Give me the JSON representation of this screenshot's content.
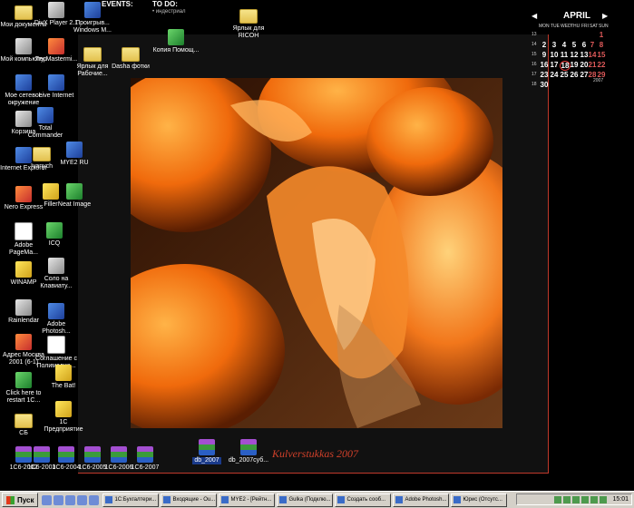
{
  "desktop_left_icons": [
    {
      "label": "Мои документы",
      "icon": "folder-icon"
    },
    {
      "label": "Мой компьютер",
      "icon": "computer-icon"
    },
    {
      "label": "Мое сетевое окружение",
      "icon": "network-icon"
    },
    {
      "label": "Корзина",
      "icon": "recycle-bin-icon"
    },
    {
      "label": "Internet Explorer",
      "icon": "ie-icon"
    },
    {
      "label": "Nero Express",
      "icon": "nero-icon"
    },
    {
      "label": "Adobe PageMa...",
      "icon": "pagemaker-icon"
    },
    {
      "label": "WINAMP",
      "icon": "winamp-icon"
    },
    {
      "label": "Rainlendar",
      "icon": "rainlendar-icon"
    },
    {
      "label": "Адрес Москва 2001 (6-1)",
      "icon": "globe-icon"
    },
    {
      "label": "Click here to restart 1С...",
      "icon": "restart-icon"
    },
    {
      "label": "СБ",
      "icon": "folder-icon"
    }
  ],
  "desktop_col2_icons": [
    {
      "label": "DivX Player 2.1",
      "icon": "divx-icon"
    },
    {
      "label": "Try Mastermi...",
      "icon": "mastermind-icon"
    },
    {
      "label": "Live Internet",
      "icon": "live-internet-icon"
    },
    {
      "label": "Total Commander",
      "icon": "total-commander-icon"
    },
    {
      "label": "Ivanych",
      "icon": "folder-icon"
    },
    {
      "label": "Filler",
      "icon": "filler-icon"
    },
    {
      "label": "ICQ",
      "icon": "icq-icon"
    },
    {
      "label": "Соло на Клавиату...",
      "icon": "keyboard-icon"
    },
    {
      "label": "Adobe Photosh...",
      "icon": "photoshop-icon"
    },
    {
      "label": "Соглашение с Полимедиа...",
      "icon": "document-icon"
    },
    {
      "label": "The Bat!",
      "icon": "bat-icon"
    },
    {
      "label": "1С Предприятие",
      "icon": "1c-icon"
    }
  ],
  "desktop_col3_icons": [
    {
      "label": "Проигрыв... Windows M...",
      "icon": "media-player-icon"
    },
    {
      "label": "Ярлык для Рабочие...",
      "icon": "folder-icon"
    },
    {
      "label": "MYE2 RU",
      "icon": "mye2-icon"
    },
    {
      "label": "Neat Image",
      "icon": "neat-image-icon"
    }
  ],
  "desktop_top_icons": [
    {
      "label": "Dasha фотки",
      "icon": "folder-icon"
    },
    {
      "label": "Копия Помощ...",
      "icon": "excel-icon"
    },
    {
      "label": "Ярлык для RICOH",
      "icon": "folder-icon"
    }
  ],
  "desktop_bottom_icons": [
    {
      "label": "1С6-2002"
    },
    {
      "label": "1С6-2003"
    },
    {
      "label": "1С6-2004"
    },
    {
      "label": "1С6-2005"
    },
    {
      "label": "1С6-2006"
    },
    {
      "label": "1С6-2007"
    }
  ],
  "archives": [
    {
      "label": "db_2007"
    },
    {
      "label": "db_2007суб..."
    }
  ],
  "widgets": {
    "events_label": "EVENTS:",
    "todo_label": "TO DO:",
    "todo_item": "• индестриал"
  },
  "signature": "Kulverstukkas 2007",
  "calendar": {
    "month": "APRIL",
    "year": "2007",
    "weekdays": [
      "MON",
      "TUE",
      "WED",
      "THU",
      "FRI",
      "SAT",
      "SUN"
    ],
    "week_numbers": [
      "13",
      "14",
      "15",
      "16",
      "17",
      "18"
    ],
    "today": "18"
  },
  "taskbar": {
    "start_label": "Пуск",
    "tasks": [
      "1С:Бухгалтери...",
      "Входящие - Ou...",
      "MYE2 - [Рейтн...",
      "Gulka (Подклю...",
      "Создать сооб...",
      "Adobe Photosh...",
      "Юрис (Отсутс..."
    ],
    "clock": "15:01"
  },
  "colors": {
    "accent_red": "#c0392b",
    "weekend_red": "#e05a5a"
  }
}
